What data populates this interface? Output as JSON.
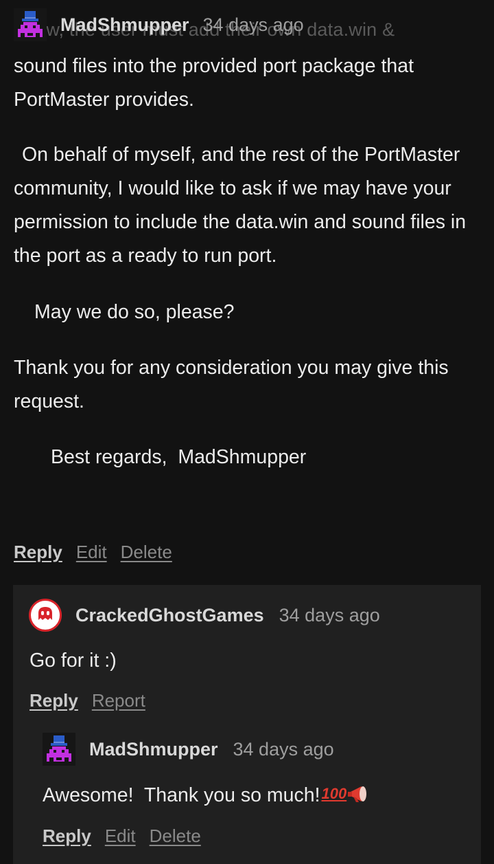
{
  "comment_main": {
    "avatar_icon": "space-invader-top-hat-avatar",
    "partial_top_text": "r now, the user must add their own data.win &",
    "username": "MadShmupper",
    "timestamp": "34 days ago",
    "paragraphs": [
      "sound files into the provided port package that PortMaster provides.",
      "On behalf of myself, and the rest of the PortMaster community, I would like to ask if we may have your permission to include the data.win and sound files in the port as a ready to run port.",
      "May we do so, please?",
      "Thank you for any consideration you may give this request.",
      "Best regards,  MadShmupper"
    ],
    "actions": {
      "reply": "Reply",
      "edit": "Edit",
      "delete": "Delete"
    }
  },
  "reply_1": {
    "avatar_icon": "ghost-logo-avatar",
    "username": "CrackedGhostGames",
    "timestamp": "34 days ago",
    "text": "Go for it :)",
    "actions": {
      "reply": "Reply",
      "report": "Report"
    }
  },
  "reply_2": {
    "avatar_icon": "space-invader-top-hat-avatar",
    "username": "MadShmupper",
    "timestamp": "34 days ago",
    "text": "Awesome!  Thank you so much!",
    "emoji": [
      "hundred-points-emoji",
      "megaphone-emoji"
    ],
    "actions": {
      "reply": "Reply",
      "edit": "Edit",
      "delete": "Delete"
    }
  },
  "colors": {
    "background": "#121212",
    "reply_background": "#202020",
    "text": "#ececec",
    "muted": "#8a8a8a",
    "accent_red": "#d8242a",
    "avatar_purple": "#c230e0"
  }
}
